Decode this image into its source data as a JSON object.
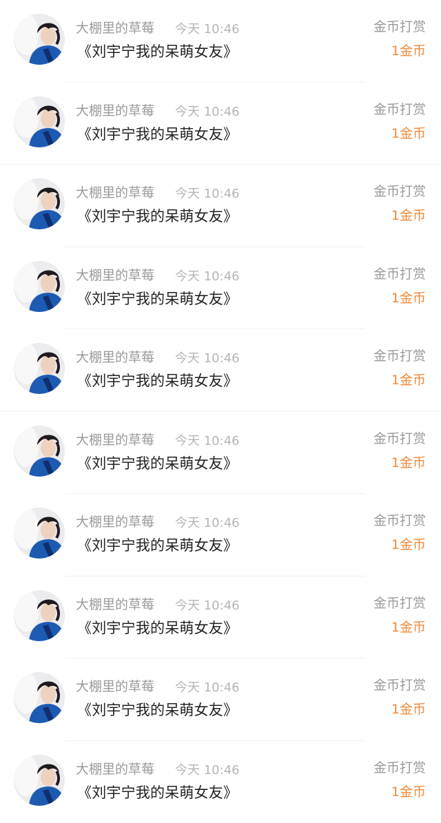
{
  "colors": {
    "accent": "#f08a3c",
    "name_text": "#9b9b9b",
    "time_text": "#b5b5b5",
    "title_text": "#222222",
    "divider": "#f1f1f1"
  },
  "records": [
    {
      "user": "大棚里的草莓",
      "time": "今天 10:46",
      "title": "《刘宇宁我的呆萌女友》",
      "label": "金币打赏",
      "amount": "1金币"
    },
    {
      "user": "大棚里的草莓",
      "time": "今天 10:46",
      "title": "《刘宇宁我的呆萌女友》",
      "label": "金币打赏",
      "amount": "1金币"
    },
    {
      "user": "大棚里的草莓",
      "time": "今天 10:46",
      "title": "《刘宇宁我的呆萌女友》",
      "label": "金币打赏",
      "amount": "1金币"
    },
    {
      "user": "大棚里的草莓",
      "time": "今天 10:46",
      "title": "《刘宇宁我的呆萌女友》",
      "label": "金币打赏",
      "amount": "1金币"
    },
    {
      "user": "大棚里的草莓",
      "time": "今天 10:46",
      "title": "《刘宇宁我的呆萌女友》",
      "label": "金币打赏",
      "amount": "1金币"
    },
    {
      "user": "大棚里的草莓",
      "time": "今天 10:46",
      "title": "《刘宇宁我的呆萌女友》",
      "label": "金币打赏",
      "amount": "1金币"
    },
    {
      "user": "大棚里的草莓",
      "time": "今天 10:46",
      "title": "《刘宇宁我的呆萌女友》",
      "label": "金币打赏",
      "amount": "1金币"
    },
    {
      "user": "大棚里的草莓",
      "time": "今天 10:46",
      "title": "《刘宇宁我的呆萌女友》",
      "label": "金币打赏",
      "amount": "1金币"
    },
    {
      "user": "大棚里的草莓",
      "time": "今天 10:46",
      "title": "《刘宇宁我的呆萌女友》",
      "label": "金币打赏",
      "amount": "1金币"
    },
    {
      "user": "大棚里的草莓",
      "time": "今天 10:46",
      "title": "《刘宇宁我的呆萌女友》",
      "label": "金币打赏",
      "amount": "1金币"
    }
  ]
}
